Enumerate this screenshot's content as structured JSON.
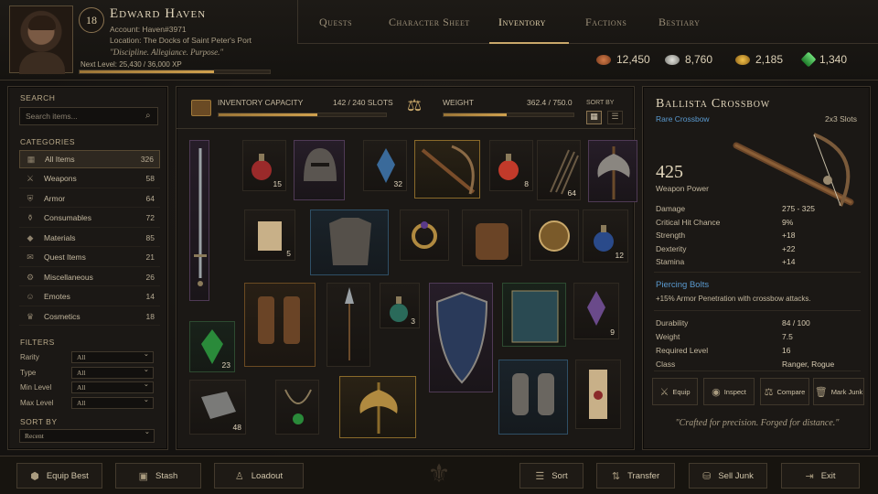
{
  "player": {
    "name": "Edward Haven",
    "level": "18",
    "account": "Account: Haven#3971",
    "location": "Location: The Docks of Saint Peter's Port",
    "motto": "\"Discipline. Allegiance. Purpose.\"",
    "xp_label": "Next Level: 25,430 / 36,000 XP",
    "xp_fraction": 0.706
  },
  "nav": {
    "tabs": [
      "Quests",
      "Character Sheet",
      "Inventory",
      "Factions",
      "Bestiary"
    ],
    "active": "Inventory"
  },
  "currencies": [
    {
      "icon": "copper-coins-icon",
      "value": "12,450",
      "color": "#b5643a"
    },
    {
      "icon": "silver-coins-icon",
      "value": "8,760",
      "color": "#b9b9b4"
    },
    {
      "icon": "gold-coins-icon",
      "value": "2,185",
      "color": "#d6a434"
    },
    {
      "icon": "green-gem-icon",
      "value": "1,340",
      "color": "#3fae4e"
    }
  ],
  "sidebar": {
    "search_label": "SEARCH",
    "search_placeholder": "Search items...",
    "categories_label": "CATEGORIES",
    "categories": [
      {
        "label": "All Items",
        "count": "326",
        "icon": "grid-icon"
      },
      {
        "label": "Weapons",
        "count": "58",
        "icon": "sword-icon"
      },
      {
        "label": "Armor",
        "count": "64",
        "icon": "shield-icon"
      },
      {
        "label": "Consumables",
        "count": "72",
        "icon": "potion-icon"
      },
      {
        "label": "Materials",
        "count": "85",
        "icon": "ore-icon"
      },
      {
        "label": "Quest Items",
        "count": "21",
        "icon": "scroll-icon"
      },
      {
        "label": "Miscellaneous",
        "count": "26",
        "icon": "misc-icon"
      },
      {
        "label": "Emotes",
        "count": "14",
        "icon": "emote-icon"
      },
      {
        "label": "Cosmetics",
        "count": "18",
        "icon": "cosmetics-icon"
      }
    ],
    "filters_label": "FILTERS",
    "filters": [
      {
        "label": "Rarity",
        "value": "All"
      },
      {
        "label": "Type",
        "value": "All"
      },
      {
        "label": "Min Level",
        "value": "All"
      },
      {
        "label": "Max Level",
        "value": "All"
      }
    ],
    "sort_label": "SORT BY",
    "sort_value": "Recent"
  },
  "capacity": {
    "inv_label": "INVENTORY CAPACITY",
    "inv_value": "142 / 240 SLOTS",
    "inv_fraction": 0.592,
    "weight_label": "WEIGHT",
    "weight_value": "362.4 / 750.0",
    "weight_fraction": 0.483,
    "sort_by_label": "SORT BY"
  },
  "grid_items": [
    {
      "name": "longsword",
      "qty": "",
      "rarity": "purple"
    },
    {
      "name": "red-potion",
      "qty": "15",
      "rarity": ""
    },
    {
      "name": "helmet",
      "qty": "",
      "rarity": "purple"
    },
    {
      "name": "blue-crystal",
      "qty": "32",
      "rarity": ""
    },
    {
      "name": "crossbow",
      "qty": "",
      "rarity": "gold"
    },
    {
      "name": "health-potion",
      "qty": "8",
      "rarity": ""
    },
    {
      "name": "arrows",
      "qty": "64",
      "rarity": ""
    },
    {
      "name": "battle-axe",
      "qty": "",
      "rarity": "purple"
    },
    {
      "name": "parchment",
      "qty": "5",
      "rarity": ""
    },
    {
      "name": "chestplate",
      "qty": "",
      "rarity": "blue"
    },
    {
      "name": "ring",
      "qty": "",
      "rarity": ""
    },
    {
      "name": "backpack",
      "qty": "",
      "rarity": ""
    },
    {
      "name": "compass-amulet",
      "qty": "",
      "rarity": ""
    },
    {
      "name": "blue-potion",
      "qty": "12",
      "rarity": ""
    },
    {
      "name": "boots",
      "qty": "",
      "rarity": "orange"
    },
    {
      "name": "spear",
      "qty": "",
      "rarity": ""
    },
    {
      "name": "green-flask",
      "qty": "3",
      "rarity": ""
    },
    {
      "name": "kite-shield",
      "qty": "",
      "rarity": "purple"
    },
    {
      "name": "spellbook",
      "qty": "",
      "rarity": "green"
    },
    {
      "name": "purple-crystal",
      "qty": "9",
      "rarity": ""
    },
    {
      "name": "green-gem",
      "qty": "23",
      "rarity": "green"
    },
    {
      "name": "iron-ingot",
      "qty": "48",
      "rarity": ""
    },
    {
      "name": "emerald-necklace",
      "qty": "",
      "rarity": ""
    },
    {
      "name": "golden-axe",
      "qty": "",
      "rarity": "gold"
    },
    {
      "name": "gauntlets",
      "qty": "",
      "rarity": "blue"
    },
    {
      "name": "sealed-scroll",
      "qty": "",
      "rarity": ""
    }
  ],
  "detail": {
    "name": "Ballista Crossbow",
    "rarity": "Rare Crossbow",
    "size": "2x3 Slots",
    "power": "425",
    "power_label": "Weapon Power",
    "stats": [
      {
        "label": "Damage",
        "value": "275 - 325"
      },
      {
        "label": "Critical Hit Chance",
        "value": "9%"
      },
      {
        "label": "Strength",
        "value": "+18"
      },
      {
        "label": "Dexterity",
        "value": "+22"
      },
      {
        "label": "Stamina",
        "value": "+14"
      }
    ],
    "perk_name": "Piercing Bolts",
    "perk_desc": "+15% Armor Penetration with crossbow attacks.",
    "info": [
      {
        "label": "Durability",
        "value": "84 / 100"
      },
      {
        "label": "Weight",
        "value": "7.5"
      },
      {
        "label": "Required Level",
        "value": "16"
      },
      {
        "label": "Class",
        "value": "Ranger, Rogue"
      }
    ],
    "actions": [
      "Equip",
      "Inspect",
      "Compare",
      "Mark Junk"
    ],
    "flavor": "\"Crafted for precision. Forged for distance.\""
  },
  "footer": {
    "left": [
      "Equip Best",
      "Stash",
      "Loadout"
    ],
    "right": [
      "Sort",
      "Transfer",
      "Sell Junk",
      "Exit"
    ]
  }
}
